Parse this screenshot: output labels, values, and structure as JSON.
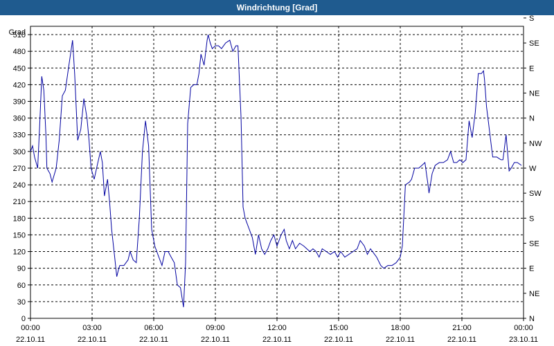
{
  "window": {
    "title": "Windrichtung [Grad]"
  },
  "chart_data": {
    "type": "line",
    "title": "Windrichtung [Grad]",
    "ylabel": "Grad",
    "ylim": [
      0,
      525
    ],
    "yticks": [
      0,
      30,
      60,
      90,
      120,
      150,
      180,
      210,
      240,
      270,
      300,
      330,
      360,
      390,
      420,
      450,
      480,
      510
    ],
    "right_axis_labels": [
      {
        "value": 0,
        "label": "N"
      },
      {
        "value": 45,
        "label": "NE"
      },
      {
        "value": 90,
        "label": "E"
      },
      {
        "value": 135,
        "label": "SE"
      },
      {
        "value": 180,
        "label": "S"
      },
      {
        "value": 225,
        "label": "SW"
      },
      {
        "value": 270,
        "label": "W"
      },
      {
        "value": 315,
        "label": "NW"
      },
      {
        "value": 360,
        "label": "N"
      },
      {
        "value": 405,
        "label": "NE"
      },
      {
        "value": 450,
        "label": "E"
      },
      {
        "value": 495,
        "label": "SE"
      },
      {
        "value": 540,
        "label": "S"
      }
    ],
    "x_axis_hours_range": [
      0,
      24
    ],
    "x_ticks": [
      {
        "hour": 0,
        "time": "00:00",
        "date": "22.10.11"
      },
      {
        "hour": 3,
        "time": "03:00",
        "date": "22.10.11"
      },
      {
        "hour": 6,
        "time": "06:00",
        "date": "22.10.11"
      },
      {
        "hour": 9,
        "time": "09:00",
        "date": "22.10.11"
      },
      {
        "hour": 12,
        "time": "12:00",
        "date": "22.10.11"
      },
      {
        "hour": 15,
        "time": "15:00",
        "date": "22.10.11"
      },
      {
        "hour": 18,
        "time": "18:00",
        "date": "22.10.11"
      },
      {
        "hour": 21,
        "time": "21:00",
        "date": "22.10.11"
      },
      {
        "hour": 24,
        "time": "00:00",
        "date": "23.10.11"
      }
    ],
    "grid": true,
    "series_color": "#0000a0",
    "series": [
      {
        "points": [
          [
            0.0,
            300
          ],
          [
            0.1,
            310
          ],
          [
            0.2,
            290
          ],
          [
            0.35,
            270
          ],
          [
            0.45,
            350
          ],
          [
            0.55,
            435
          ],
          [
            0.65,
            410
          ],
          [
            0.75,
            330
          ],
          [
            0.8,
            270
          ],
          [
            0.95,
            260
          ],
          [
            1.05,
            245
          ],
          [
            1.25,
            270
          ],
          [
            1.4,
            320
          ],
          [
            1.55,
            400
          ],
          [
            1.7,
            410
          ],
          [
            1.85,
            450
          ],
          [
            2.05,
            500
          ],
          [
            2.15,
            440
          ],
          [
            2.3,
            320
          ],
          [
            2.45,
            340
          ],
          [
            2.6,
            395
          ],
          [
            2.75,
            360
          ],
          [
            2.85,
            320
          ],
          [
            2.95,
            270
          ],
          [
            3.1,
            250
          ],
          [
            3.25,
            275
          ],
          [
            3.4,
            300
          ],
          [
            3.5,
            280
          ],
          [
            3.6,
            220
          ],
          [
            3.75,
            250
          ],
          [
            3.85,
            210
          ],
          [
            3.95,
            160
          ],
          [
            4.1,
            110
          ],
          [
            4.2,
            75
          ],
          [
            4.3,
            90
          ],
          [
            4.35,
            95
          ],
          [
            4.55,
            95
          ],
          [
            4.75,
            105
          ],
          [
            4.85,
            120
          ],
          [
            5.0,
            105
          ],
          [
            5.15,
            100
          ],
          [
            5.3,
            180
          ],
          [
            5.45,
            300
          ],
          [
            5.6,
            355
          ],
          [
            5.75,
            310
          ],
          [
            5.9,
            160
          ],
          [
            6.05,
            130
          ],
          [
            6.2,
            115
          ],
          [
            6.4,
            95
          ],
          [
            6.55,
            120
          ],
          [
            6.7,
            120
          ],
          [
            6.85,
            110
          ],
          [
            7.0,
            100
          ],
          [
            7.15,
            60
          ],
          [
            7.3,
            55
          ],
          [
            7.45,
            20
          ],
          [
            7.55,
            100
          ],
          [
            7.65,
            350
          ],
          [
            7.8,
            415
          ],
          [
            7.95,
            420
          ],
          [
            8.1,
            420
          ],
          [
            8.2,
            440
          ],
          [
            8.3,
            475
          ],
          [
            8.45,
            455
          ],
          [
            8.6,
            500
          ],
          [
            8.65,
            510
          ],
          [
            8.75,
            495
          ],
          [
            8.85,
            485
          ],
          [
            9.0,
            490
          ],
          [
            9.15,
            490
          ],
          [
            9.3,
            485
          ],
          [
            9.5,
            495
          ],
          [
            9.7,
            500
          ],
          [
            9.85,
            480
          ],
          [
            10.0,
            490
          ],
          [
            10.1,
            490
          ],
          [
            10.25,
            360
          ],
          [
            10.35,
            200
          ],
          [
            10.45,
            180
          ],
          [
            10.55,
            170
          ],
          [
            10.65,
            160
          ],
          [
            10.8,
            145
          ],
          [
            10.95,
            115
          ],
          [
            11.1,
            150
          ],
          [
            11.25,
            125
          ],
          [
            11.4,
            115
          ],
          [
            11.55,
            125
          ],
          [
            11.7,
            140
          ],
          [
            11.85,
            150
          ],
          [
            12.0,
            130
          ],
          [
            12.2,
            150
          ],
          [
            12.35,
            160
          ],
          [
            12.45,
            140
          ],
          [
            12.6,
            125
          ],
          [
            12.75,
            140
          ],
          [
            12.9,
            125
          ],
          [
            13.1,
            135
          ],
          [
            13.3,
            130
          ],
          [
            13.45,
            125
          ],
          [
            13.6,
            120
          ],
          [
            13.75,
            125
          ],
          [
            13.9,
            120
          ],
          [
            14.05,
            110
          ],
          [
            14.2,
            125
          ],
          [
            14.4,
            120
          ],
          [
            14.6,
            115
          ],
          [
            14.8,
            120
          ],
          [
            14.95,
            110
          ],
          [
            15.1,
            120
          ],
          [
            15.3,
            110
          ],
          [
            15.5,
            115
          ],
          [
            15.7,
            120
          ],
          [
            15.9,
            125
          ],
          [
            16.05,
            140
          ],
          [
            16.25,
            130
          ],
          [
            16.4,
            115
          ],
          [
            16.55,
            125
          ],
          [
            16.75,
            115
          ],
          [
            16.85,
            110
          ],
          [
            17.05,
            95
          ],
          [
            17.2,
            90
          ],
          [
            17.4,
            95
          ],
          [
            17.6,
            95
          ],
          [
            17.8,
            100
          ],
          [
            18.0,
            110
          ],
          [
            18.1,
            130
          ],
          [
            18.25,
            240
          ],
          [
            18.45,
            245
          ],
          [
            18.55,
            250
          ],
          [
            18.7,
            270
          ],
          [
            18.9,
            270
          ],
          [
            19.05,
            275
          ],
          [
            19.2,
            280
          ],
          [
            19.35,
            240
          ],
          [
            19.4,
            225
          ],
          [
            19.55,
            260
          ],
          [
            19.7,
            275
          ],
          [
            19.9,
            280
          ],
          [
            20.1,
            280
          ],
          [
            20.3,
            285
          ],
          [
            20.45,
            300
          ],
          [
            20.6,
            280
          ],
          [
            20.75,
            280
          ],
          [
            20.9,
            285
          ],
          [
            21.05,
            280
          ],
          [
            21.2,
            285
          ],
          [
            21.35,
            355
          ],
          [
            21.5,
            325
          ],
          [
            21.65,
            370
          ],
          [
            21.8,
            440
          ],
          [
            21.95,
            440
          ],
          [
            22.05,
            445
          ],
          [
            22.1,
            430
          ],
          [
            22.2,
            380
          ],
          [
            22.3,
            350
          ],
          [
            22.4,
            320
          ],
          [
            22.5,
            290
          ],
          [
            22.7,
            290
          ],
          [
            22.9,
            285
          ],
          [
            23.0,
            285
          ],
          [
            23.15,
            330
          ],
          [
            23.3,
            265
          ],
          [
            23.4,
            270
          ],
          [
            23.55,
            280
          ],
          [
            23.7,
            280
          ],
          [
            23.9,
            275
          ]
        ]
      }
    ]
  }
}
